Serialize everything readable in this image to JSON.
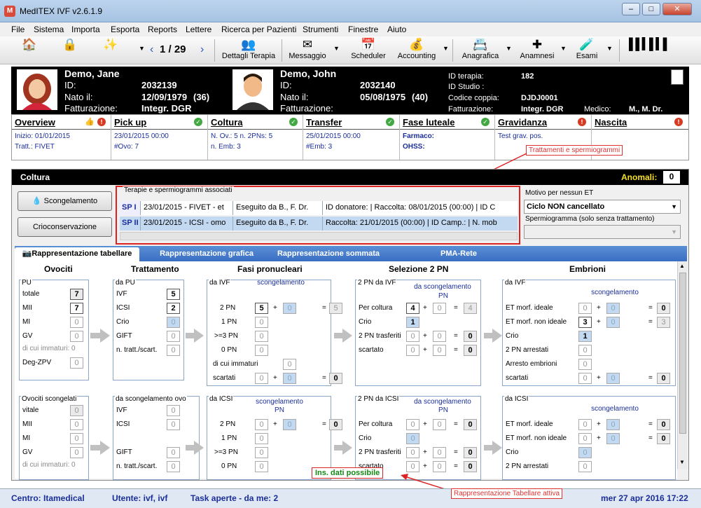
{
  "window": {
    "title": "MedITEX IVF v2.6.1.9",
    "app_icon": "M",
    "min": "–",
    "max": "□",
    "close": "✕"
  },
  "menu": [
    "File",
    "Sistema",
    "Importa",
    "Esporta",
    "Reports",
    "Lettere",
    "Ricerca per Pazienti",
    "Strumenti",
    "Finestre",
    "Aiuto"
  ],
  "toolbar": {
    "pager": "1 / 29",
    "dettagli": "Dettagli Terapia",
    "messaggio": "Messaggio",
    "scheduler": "Scheduler",
    "accounting": "Accounting",
    "anagrafica": "Anagrafica",
    "anamnesi": "Anamnesi",
    "esami": "Esami"
  },
  "patient_f": {
    "name": "Demo, Jane",
    "id_label": "ID:",
    "id": "2032139",
    "born_label": "Nato il:",
    "born": "12/09/1979",
    "age": "(36)",
    "fatt_label": "Fatturazione:",
    "fatt": "Integr. DGR"
  },
  "patient_m": {
    "name": "Demo, John",
    "id_label": "ID:",
    "id": "2032140",
    "born_label": "Nato il:",
    "born": "05/08/1975",
    "age": "(40)",
    "fatt_label": "Fatturazione:"
  },
  "therapy": {
    "idt_label": "ID terapia:",
    "idt": "182",
    "ids_label": "ID Studio :",
    "cc_label": "Codice coppia:",
    "cc": "DJDJ0001",
    "fatt_label": "Fatturazione:",
    "fatt": "Integr. DGR",
    "med_label": "Medico:",
    "med": "M., M. Dr."
  },
  "tabs": [
    {
      "h": "Overview",
      "l1": "Inizio: 01/01/2015",
      "l2": "Tratt.: FIVET"
    },
    {
      "h": "Pick up",
      "l1": "23/01/2015 00:00",
      "l2": "#Ovo: 7"
    },
    {
      "h": "Coltura",
      "l1": "N. Ov.: 5 n. 2PNs: 5",
      "l2": "n. Emb: 3"
    },
    {
      "h": "Transfer",
      "l1": "25/01/2015 00:00",
      "l2": "#Emb: 3"
    },
    {
      "h": "Fase luteale",
      "l1": "Farmaco:",
      "l2": "OHSS:"
    },
    {
      "h": "Gravidanza",
      "l1": "Test grav. pos.",
      "l2": ""
    },
    {
      "h": "Nascita",
      "l1": "",
      "l2": ""
    }
  ],
  "annot1": "Trattamenti e spermiogrammi",
  "annot2": "Rappresentazione Tabellare attiva",
  "coltura": {
    "title": "Coltura",
    "anom_label": "Anomali:",
    "anom": "0",
    "btn_scong": "Scongelamento",
    "btn_crio": "Crioconservazione",
    "assoc_title": "Terapie e spermiogrammi associati",
    "rows": [
      [
        "SP I",
        "23/01/2015 - FIVET - et",
        "Eseguito da B., F. Dr.",
        "ID donatore:  | Raccolta: 08/01/2015 (00:00)  | ID C"
      ],
      [
        "SP II",
        "23/01/2015 - ICSI - omo",
        "Eseguito da B., F. Dr.",
        "Raccolta: 21/01/2015 (00:00)  | ID Camp.:  | N. mob"
      ]
    ],
    "motivo_label": "Motivo per nessun ET",
    "motivo": "Ciclo NON cancellato",
    "sperm_label": "Spermiogramma (solo senza trattamento)"
  },
  "subtabs": [
    "Rappresentazione tabellare",
    "Rappresentazione grafica",
    "Rappresentazione sommata",
    "PMA-Rete"
  ],
  "grid": {
    "h": [
      "Ovociti",
      "Trattamento",
      "Fasi pronucleari",
      "Selezione 2 PN",
      "Embrioni"
    ],
    "pu": {
      "t": "PU",
      "totale": "totale",
      "mii": "MII",
      "mi": "MI",
      "gv": "GV",
      "imm": "di cui immaturi: 0",
      "deg": "Deg-ZPV",
      "v": [
        "7",
        "7",
        "0",
        "0",
        "0"
      ]
    },
    "dapu": {
      "t": "da PU",
      "ivf": "IVF",
      "icsi": "ICSI",
      "crio": "Crio",
      "gift": "GIFT",
      "ntr": "n. tratt./scart.",
      "v": [
        "5",
        "2",
        "0",
        "0",
        "0"
      ]
    },
    "daivf": {
      "t": "da IVF",
      "sc": "scongelamento",
      "l": [
        "2 PN",
        "1 PN",
        ">=3 PN",
        "0 PN",
        "di cui immaturi",
        "scartati"
      ],
      "v1": [
        "5",
        "0",
        "0",
        "0",
        "0",
        "0"
      ],
      "v2": [
        "0",
        "0"
      ],
      "v3": [
        "5",
        "0"
      ]
    },
    "sel_ivf": {
      "t": "2 PN da IVF",
      "sc": "da scongelamento",
      "pn": "PN",
      "l": [
        "Per coltura",
        "Crio",
        "2 PN trasferiti",
        "scartato"
      ],
      "v1": [
        "4",
        "1",
        "0",
        "0"
      ],
      "v2": [
        "0",
        "0",
        "0"
      ],
      "v3": [
        "4",
        "0",
        "0"
      ]
    },
    "emb_ivf": {
      "t": "da IVF",
      "sc": "scongelamento",
      "l": [
        "ET morf. ideale",
        "ET morf. non ideale",
        "Crio",
        "2 PN arrestati",
        "Arresto embrioni",
        "scartati"
      ],
      "v1": [
        "0",
        "3",
        "1",
        "0",
        "0",
        "0"
      ],
      "v2": [
        "0",
        "0",
        "0"
      ],
      "v3": [
        "0",
        "3",
        "0"
      ]
    },
    "ovsc": {
      "t": "Ovociti scongelati",
      "l": [
        "vitale",
        "MII",
        "MI",
        "GV"
      ],
      "imm": "di cui immaturi: 0",
      "v": [
        "0",
        "0",
        "0",
        "0"
      ]
    },
    "dasc": {
      "t": "da scongelamento ovo",
      "l": [
        "IVF",
        "ICSI",
        "",
        "GIFT",
        "n. tratt./scart."
      ],
      "v": [
        "0",
        "0",
        "0",
        "0"
      ]
    },
    "daicsi": {
      "t": "da ICSI",
      "sc": "scongelamento",
      "pn": "PN",
      "l": [
        "2 PN",
        "1 PN",
        ">=3 PN",
        "0 PN"
      ],
      "v1": [
        "0",
        "0",
        "0",
        "0"
      ],
      "v2": [
        "0"
      ],
      "v3": [
        "0"
      ]
    },
    "sel_icsi": {
      "t": "2 PN da ICSI",
      "sc": "da scongelamento",
      "pn": "PN",
      "l": [
        "Per coltura",
        "Crio",
        "2 PN trasferiti",
        "scartato"
      ],
      "v1": [
        "0",
        "0",
        "0",
        "0"
      ],
      "v2": [
        "0",
        "0",
        "0"
      ],
      "v3": [
        "0",
        "0",
        "0"
      ]
    },
    "emb_icsi": {
      "t": "da ICSI",
      "sc": "scongelamento",
      "l": [
        "ET morf. ideale",
        "ET morf. non ideale",
        "Crio",
        "2 PN arrestati"
      ],
      "v1": [
        "0",
        "0",
        "0",
        "0"
      ],
      "v2": [
        "0",
        "0"
      ],
      "v3": [
        "0",
        "0"
      ]
    }
  },
  "insdati": "Ins. dati possibile",
  "status": {
    "centro": "Centro: Itamedical",
    "utente": "Utente: ivf, ivf",
    "task": "Task aperte - da me: 2",
    "date": "mer 27 apr 2016 17:22"
  }
}
